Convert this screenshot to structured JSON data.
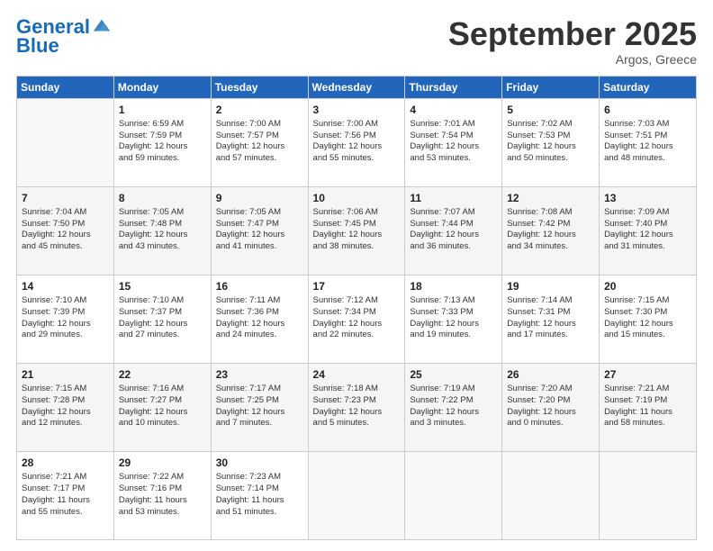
{
  "header": {
    "logo_general": "General",
    "logo_blue": "Blue",
    "month": "September 2025",
    "location": "Argos, Greece"
  },
  "days_of_week": [
    "Sunday",
    "Monday",
    "Tuesday",
    "Wednesday",
    "Thursday",
    "Friday",
    "Saturday"
  ],
  "weeks": [
    [
      {
        "day": "",
        "data": []
      },
      {
        "day": "1",
        "data": [
          "Sunrise: 6:59 AM",
          "Sunset: 7:59 PM",
          "Daylight: 12 hours",
          "and 59 minutes."
        ]
      },
      {
        "day": "2",
        "data": [
          "Sunrise: 7:00 AM",
          "Sunset: 7:57 PM",
          "Daylight: 12 hours",
          "and 57 minutes."
        ]
      },
      {
        "day": "3",
        "data": [
          "Sunrise: 7:00 AM",
          "Sunset: 7:56 PM",
          "Daylight: 12 hours",
          "and 55 minutes."
        ]
      },
      {
        "day": "4",
        "data": [
          "Sunrise: 7:01 AM",
          "Sunset: 7:54 PM",
          "Daylight: 12 hours",
          "and 53 minutes."
        ]
      },
      {
        "day": "5",
        "data": [
          "Sunrise: 7:02 AM",
          "Sunset: 7:53 PM",
          "Daylight: 12 hours",
          "and 50 minutes."
        ]
      },
      {
        "day": "6",
        "data": [
          "Sunrise: 7:03 AM",
          "Sunset: 7:51 PM",
          "Daylight: 12 hours",
          "and 48 minutes."
        ]
      }
    ],
    [
      {
        "day": "7",
        "data": [
          "Sunrise: 7:04 AM",
          "Sunset: 7:50 PM",
          "Daylight: 12 hours",
          "and 45 minutes."
        ]
      },
      {
        "day": "8",
        "data": [
          "Sunrise: 7:05 AM",
          "Sunset: 7:48 PM",
          "Daylight: 12 hours",
          "and 43 minutes."
        ]
      },
      {
        "day": "9",
        "data": [
          "Sunrise: 7:05 AM",
          "Sunset: 7:47 PM",
          "Daylight: 12 hours",
          "and 41 minutes."
        ]
      },
      {
        "day": "10",
        "data": [
          "Sunrise: 7:06 AM",
          "Sunset: 7:45 PM",
          "Daylight: 12 hours",
          "and 38 minutes."
        ]
      },
      {
        "day": "11",
        "data": [
          "Sunrise: 7:07 AM",
          "Sunset: 7:44 PM",
          "Daylight: 12 hours",
          "and 36 minutes."
        ]
      },
      {
        "day": "12",
        "data": [
          "Sunrise: 7:08 AM",
          "Sunset: 7:42 PM",
          "Daylight: 12 hours",
          "and 34 minutes."
        ]
      },
      {
        "day": "13",
        "data": [
          "Sunrise: 7:09 AM",
          "Sunset: 7:40 PM",
          "Daylight: 12 hours",
          "and 31 minutes."
        ]
      }
    ],
    [
      {
        "day": "14",
        "data": [
          "Sunrise: 7:10 AM",
          "Sunset: 7:39 PM",
          "Daylight: 12 hours",
          "and 29 minutes."
        ]
      },
      {
        "day": "15",
        "data": [
          "Sunrise: 7:10 AM",
          "Sunset: 7:37 PM",
          "Daylight: 12 hours",
          "and 27 minutes."
        ]
      },
      {
        "day": "16",
        "data": [
          "Sunrise: 7:11 AM",
          "Sunset: 7:36 PM",
          "Daylight: 12 hours",
          "and 24 minutes."
        ]
      },
      {
        "day": "17",
        "data": [
          "Sunrise: 7:12 AM",
          "Sunset: 7:34 PM",
          "Daylight: 12 hours",
          "and 22 minutes."
        ]
      },
      {
        "day": "18",
        "data": [
          "Sunrise: 7:13 AM",
          "Sunset: 7:33 PM",
          "Daylight: 12 hours",
          "and 19 minutes."
        ]
      },
      {
        "day": "19",
        "data": [
          "Sunrise: 7:14 AM",
          "Sunset: 7:31 PM",
          "Daylight: 12 hours",
          "and 17 minutes."
        ]
      },
      {
        "day": "20",
        "data": [
          "Sunrise: 7:15 AM",
          "Sunset: 7:30 PM",
          "Daylight: 12 hours",
          "and 15 minutes."
        ]
      }
    ],
    [
      {
        "day": "21",
        "data": [
          "Sunrise: 7:15 AM",
          "Sunset: 7:28 PM",
          "Daylight: 12 hours",
          "and 12 minutes."
        ]
      },
      {
        "day": "22",
        "data": [
          "Sunrise: 7:16 AM",
          "Sunset: 7:27 PM",
          "Daylight: 12 hours",
          "and 10 minutes."
        ]
      },
      {
        "day": "23",
        "data": [
          "Sunrise: 7:17 AM",
          "Sunset: 7:25 PM",
          "Daylight: 12 hours",
          "and 7 minutes."
        ]
      },
      {
        "day": "24",
        "data": [
          "Sunrise: 7:18 AM",
          "Sunset: 7:23 PM",
          "Daylight: 12 hours",
          "and 5 minutes."
        ]
      },
      {
        "day": "25",
        "data": [
          "Sunrise: 7:19 AM",
          "Sunset: 7:22 PM",
          "Daylight: 12 hours",
          "and 3 minutes."
        ]
      },
      {
        "day": "26",
        "data": [
          "Sunrise: 7:20 AM",
          "Sunset: 7:20 PM",
          "Daylight: 12 hours",
          "and 0 minutes."
        ]
      },
      {
        "day": "27",
        "data": [
          "Sunrise: 7:21 AM",
          "Sunset: 7:19 PM",
          "Daylight: 11 hours",
          "and 58 minutes."
        ]
      }
    ],
    [
      {
        "day": "28",
        "data": [
          "Sunrise: 7:21 AM",
          "Sunset: 7:17 PM",
          "Daylight: 11 hours",
          "and 55 minutes."
        ]
      },
      {
        "day": "29",
        "data": [
          "Sunrise: 7:22 AM",
          "Sunset: 7:16 PM",
          "Daylight: 11 hours",
          "and 53 minutes."
        ]
      },
      {
        "day": "30",
        "data": [
          "Sunrise: 7:23 AM",
          "Sunset: 7:14 PM",
          "Daylight: 11 hours",
          "and 51 minutes."
        ]
      },
      {
        "day": "",
        "data": []
      },
      {
        "day": "",
        "data": []
      },
      {
        "day": "",
        "data": []
      },
      {
        "day": "",
        "data": []
      }
    ]
  ]
}
